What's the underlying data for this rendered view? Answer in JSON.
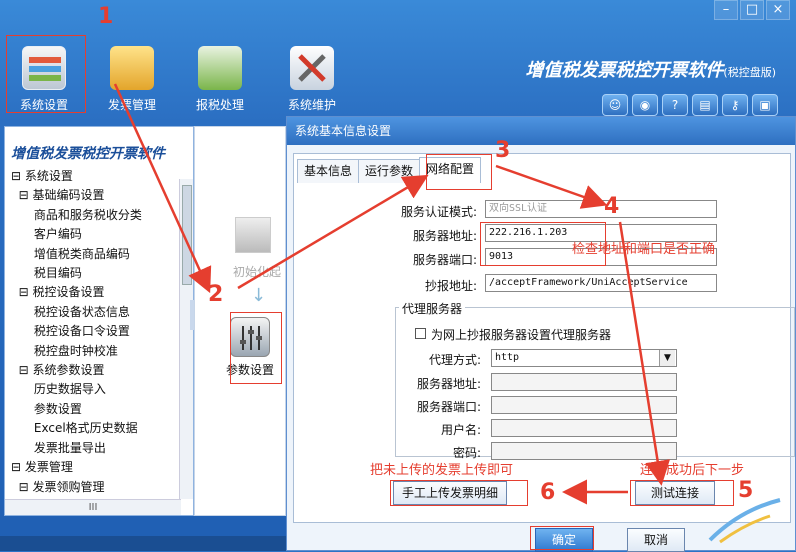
{
  "window": {
    "minimize": "–",
    "maximize": "□",
    "close": "×"
  },
  "toolbar": {
    "items": [
      {
        "label": "系统设置"
      },
      {
        "label": "发票管理"
      },
      {
        "label": "报税处理"
      },
      {
        "label": "系统维护"
      }
    ],
    "brand": "增值税发票税控开票软件",
    "brand_suffix": "(税控盘版)"
  },
  "tree": {
    "title": "增值税发票税控开票软件",
    "items": [
      "⊟ 系统设置",
      "  ⊟ 基础编码设置",
      "      商品和服务税收分类",
      "      客户编码",
      "      增值税类商品编码",
      "      税目编码",
      "  ⊟ 税控设备设置",
      "      税控设备状态信息",
      "      税控设备口令设置",
      "      税控盘时钟校准",
      "  ⊟ 系统参数设置",
      "      历史数据导入",
      "      参数设置",
      "      Excel格式历史数据",
      "      发票批量导出",
      "⊟ 发票管理",
      "  ⊟ 发票领购管理"
    ],
    "hscroll_label": "III"
  },
  "middle": {
    "init_label": "初始化起",
    "param_label": "参数设置"
  },
  "dialog": {
    "title": "系统基本信息设置",
    "tabs": [
      "基本信息",
      "运行参数",
      "网络配置"
    ],
    "fields": {
      "auth_mode_label": "服务认证模式:",
      "auth_mode_value": "双向SSL认证",
      "server_addr_label": "服务器地址:",
      "server_addr_value": "222.216.1.203",
      "server_port_label": "服务器端口:",
      "server_port_value": "9013",
      "report_addr_label": "抄报地址:",
      "report_addr_value": "/acceptFramework/UniAcceptService"
    },
    "proxy": {
      "group_title": "代理服务器",
      "checkbox_label": "为网上抄报服务器设置代理服务器",
      "mode_label": "代理方式:",
      "mode_value": "http",
      "addr_label": "服务器地址:",
      "port_label": "服务器端口:",
      "user_label": "用户名:",
      "pwd_label": "密码:"
    },
    "buttons": {
      "manual_upload": "手工上传发票明细",
      "test_connect": "测试连接",
      "ok": "确定",
      "cancel": "取消"
    }
  },
  "annotations": {
    "n1": "1",
    "n2": "2",
    "n3": "3",
    "n4": "4",
    "n5": "5",
    "n6": "6",
    "check_text": "检查地址和端口是否正确",
    "upload_text": "把未上传的发票上传即可",
    "success_text": "连接成功后下一步"
  },
  "colors": {
    "accent_red": "#e53e2f",
    "brand_blue": "#2b6fc2"
  }
}
